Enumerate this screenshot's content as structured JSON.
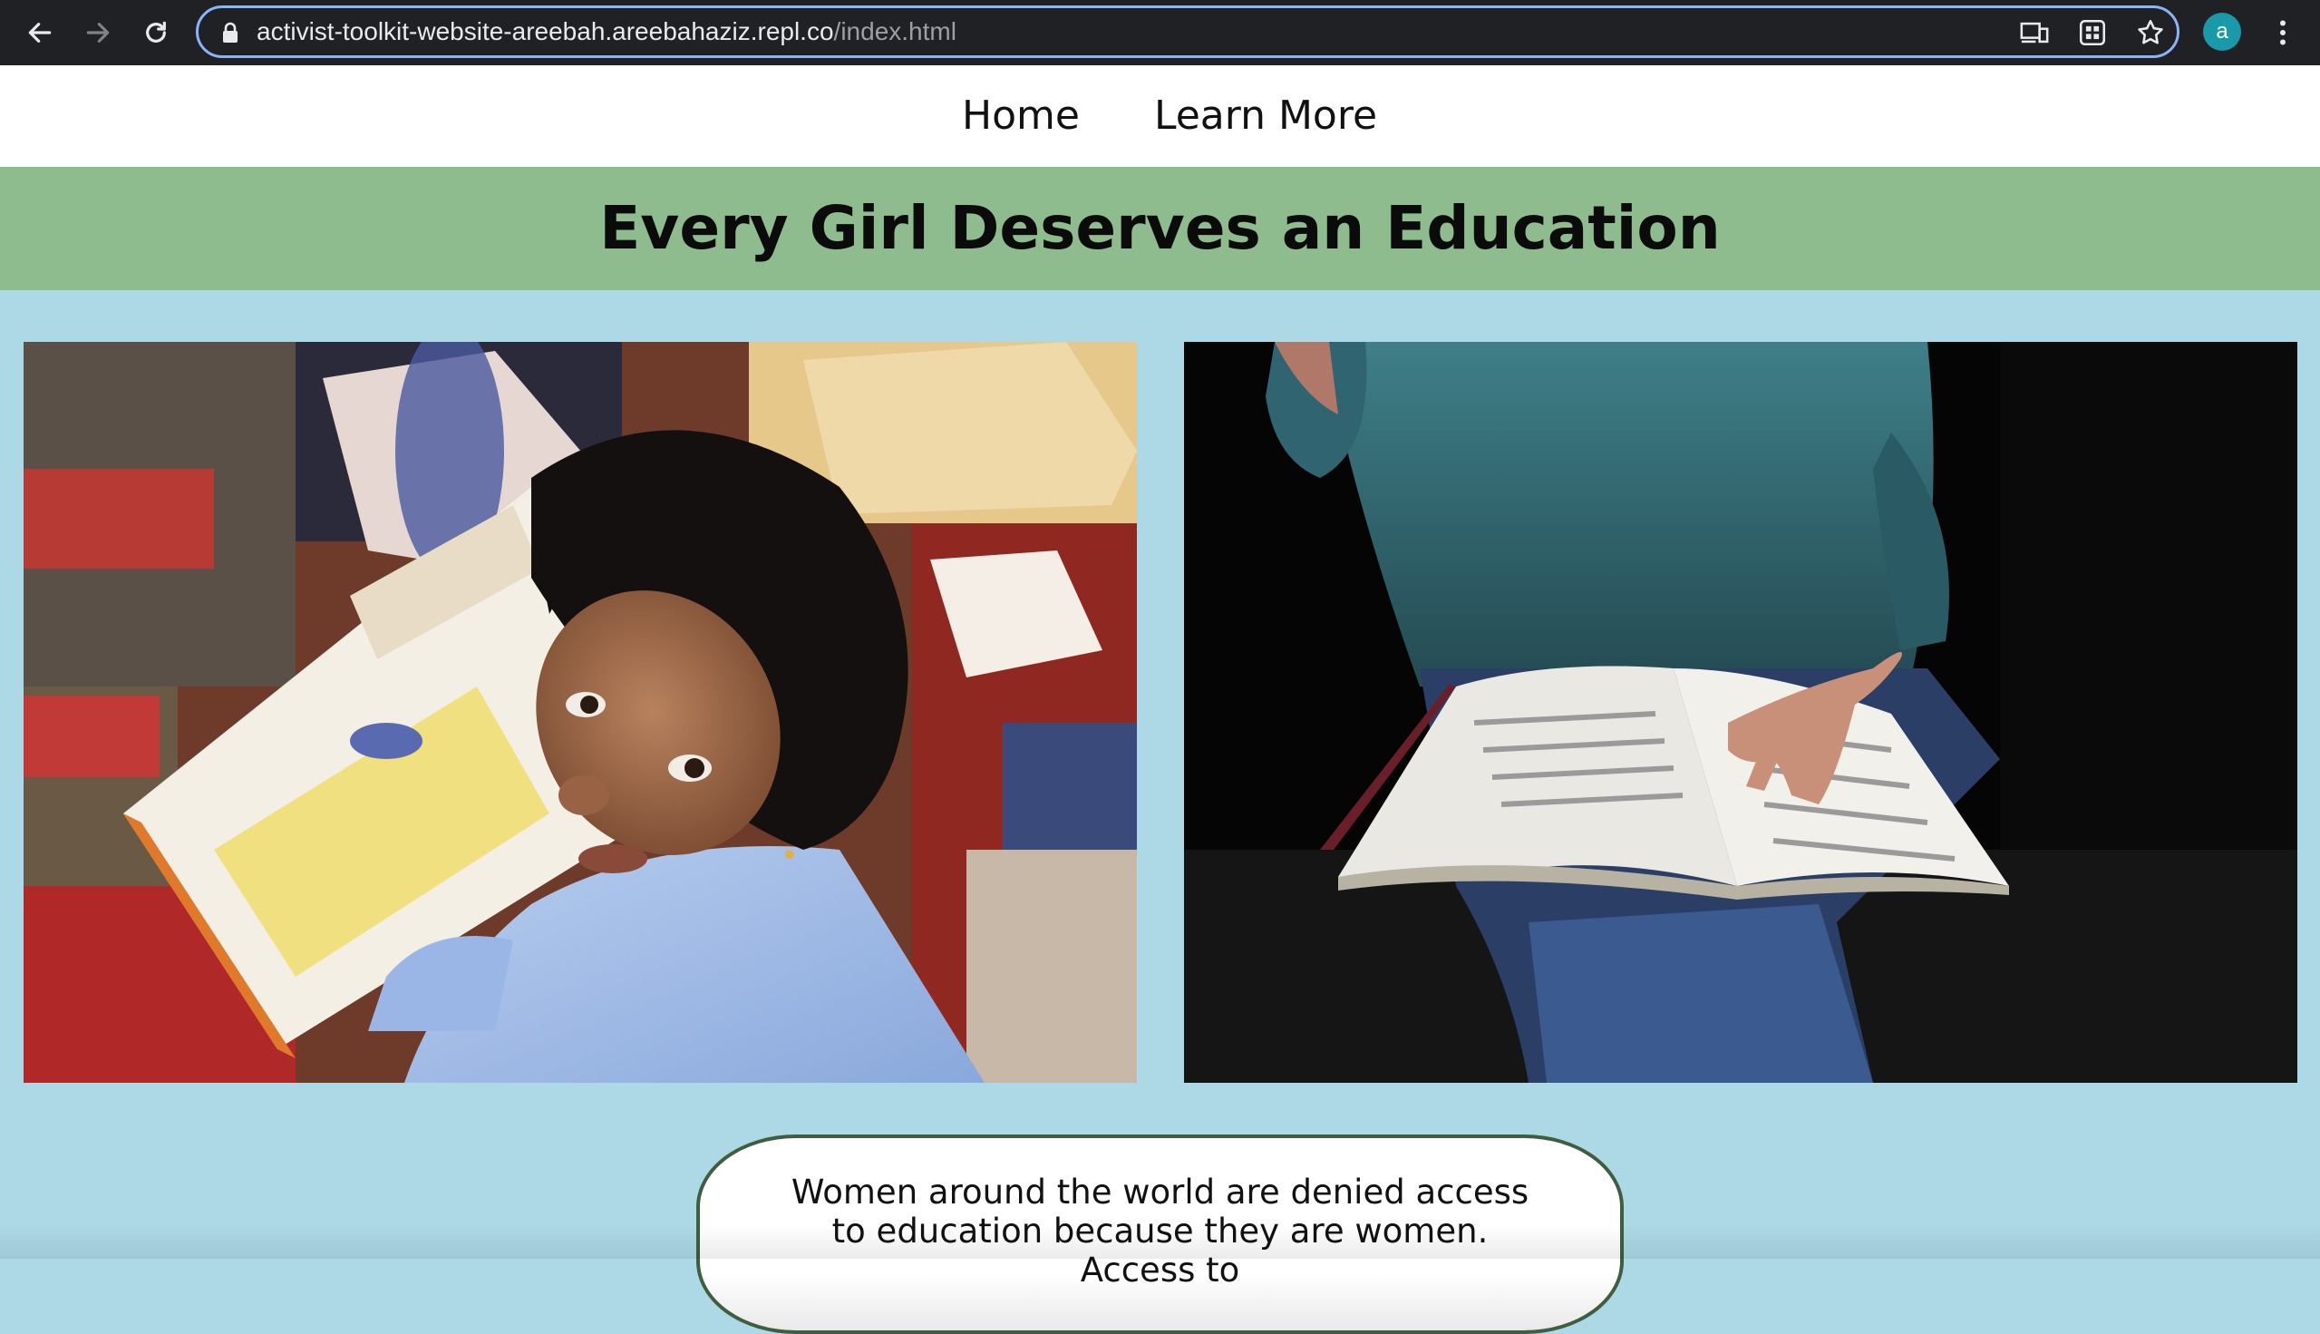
{
  "browser": {
    "url_host": "activist-toolkit-website-areebah.areebahaziz.repl.co",
    "url_path": "/index.html",
    "profile_initial": "a"
  },
  "nav": {
    "home_label": "Home",
    "learn_more_label": "Learn More"
  },
  "hero": {
    "title": "Every Girl Deserves an Education"
  },
  "card": {
    "text": "Women around the world are denied access to education because they are women. Access to"
  },
  "colors": {
    "page_background": "#add8e6",
    "banner_background": "#8fbc8f",
    "nav_background": "#ffffff",
    "card_border": "#3f5e3f"
  }
}
